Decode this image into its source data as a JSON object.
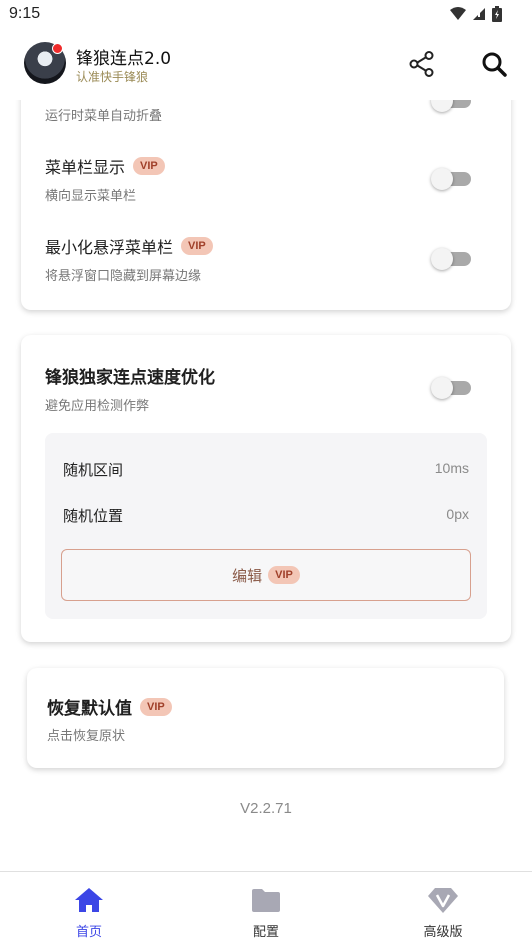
{
  "status_bar": {
    "time": "9:15"
  },
  "app_bar": {
    "title": "锋狼连点2.0",
    "subtitle": "认准快手锋狼"
  },
  "card_menu": {
    "items": [
      {
        "label": "",
        "description": "运行时菜单自动折叠",
        "vip": "",
        "enabled": false
      },
      {
        "label": "菜单栏显示",
        "description": "横向显示菜单栏",
        "vip": "VIP",
        "enabled": false
      },
      {
        "label": "最小化悬浮菜单栏",
        "description": "将悬浮窗口隐藏到屏幕边缘",
        "vip": "VIP",
        "enabled": false
      }
    ]
  },
  "card_speed": {
    "title": "锋狼独家连点速度优化",
    "description": "避免应用检测作弊",
    "enabled": false,
    "settings": [
      {
        "label": "随机区间",
        "value": "10ms"
      },
      {
        "label": "随机位置",
        "value": "0px"
      }
    ],
    "edit_label": "编辑",
    "edit_vip": "VIP"
  },
  "card_reset": {
    "title": "恢复默认值",
    "vip": "VIP",
    "description": "点击恢复原状"
  },
  "version": "V2.2.71",
  "bottom_nav": {
    "items": [
      {
        "label": "首页",
        "icon": "home-icon",
        "active": true
      },
      {
        "label": "配置",
        "icon": "folder-icon",
        "active": false
      },
      {
        "label": "高级版",
        "icon": "diamond-icon",
        "active": false
      }
    ]
  },
  "colors": {
    "accent": "#3c46e6",
    "vip_bg": "#f3c6b6",
    "vip_text": "#a0402a",
    "nav_icon": "#a8a8b4"
  }
}
